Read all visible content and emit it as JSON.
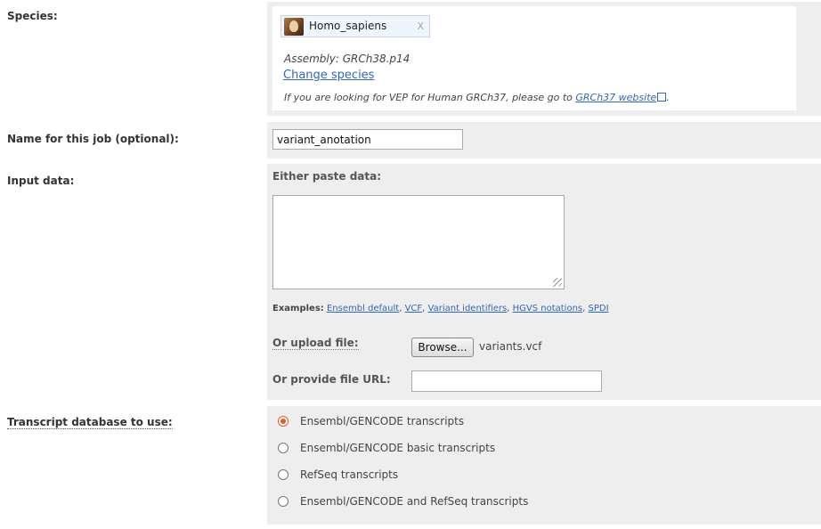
{
  "species": {
    "label": "Species:",
    "selected": "Homo_sapiens",
    "remove": "X",
    "assembly": "Assembly: GRCh38.p14",
    "change_link": "Change species",
    "grch37_prefix": "If you are looking for VEP for Human GRCh37, please go to ",
    "grch37_link": "GRCh37 website",
    "grch37_suffix": "."
  },
  "job": {
    "label": "Name for this job (optional):",
    "value": "variant_anotation"
  },
  "input": {
    "label": "Input data:",
    "paste_label": "Either paste data:",
    "paste_value": "",
    "examples_label": "Examples:",
    "examples": [
      "Ensembl default",
      "VCF",
      "Variant identifiers",
      "HGVS notations",
      "SPDI"
    ],
    "upload_label": "Or upload file:",
    "browse_label": "Browse...",
    "file_name": "variants.vcf",
    "url_label": "Or provide file URL:",
    "url_value": ""
  },
  "transcript": {
    "label": "Transcript database to use:",
    "options": [
      "Ensembl/GENCODE transcripts",
      "Ensembl/GENCODE basic transcripts",
      "RefSeq transcripts",
      "Ensembl/GENCODE and RefSeq transcripts"
    ],
    "selected_index": 0
  },
  "colors": {
    "panel_bg": "#eeeeee",
    "link": "#3366bb",
    "radio_accent": "#e05a2a"
  }
}
